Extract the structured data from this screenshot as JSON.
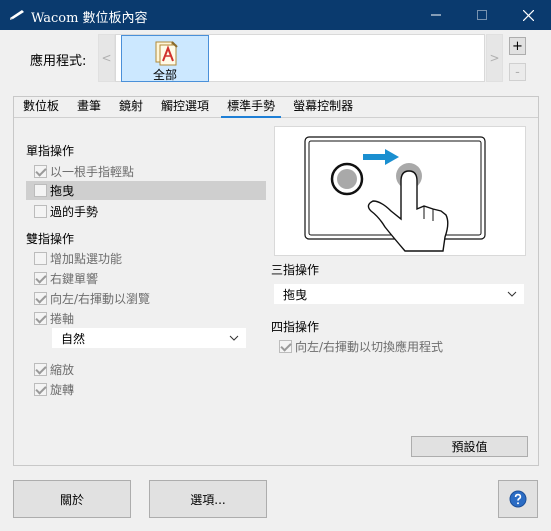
{
  "window": {
    "title": "Wacom 數位板內容"
  },
  "app_bar": {
    "label": "應用程式:",
    "left_arrow": "<",
    "right_arrow": ">",
    "selected_app": "全部",
    "add_label": "+",
    "remove_label": "-"
  },
  "tabs": [
    {
      "label": "數位板"
    },
    {
      "label": "畫筆"
    },
    {
      "label": "鏡射"
    },
    {
      "label": "觸控選項"
    },
    {
      "label": "標準手勢",
      "active": true
    },
    {
      "label": "螢幕控制器"
    }
  ],
  "single_finger": {
    "heading": "單指操作",
    "items": [
      {
        "label": "以一根手指輕點",
        "checked": true,
        "enabled": false
      },
      {
        "label": "拖曳",
        "checked": false,
        "enabled": true,
        "selected": true
      },
      {
        "label": "過的手勢",
        "checked": false,
        "enabled": true
      }
    ]
  },
  "two_finger": {
    "heading": "雙指操作",
    "items": [
      {
        "label": "增加點選功能",
        "checked": false,
        "enabled": false
      },
      {
        "label": "右鍵單響",
        "checked": true,
        "enabled": false
      },
      {
        "label": "向左/右揮動以瀏覽",
        "checked": true,
        "enabled": false
      },
      {
        "label": "捲軸",
        "checked": true,
        "enabled": false
      },
      {
        "label": "縮放",
        "checked": true,
        "enabled": false
      },
      {
        "label": "旋轉",
        "checked": true,
        "enabled": false
      }
    ],
    "scroll_select": {
      "value": "自然"
    }
  },
  "three_finger": {
    "heading": "三指操作",
    "select": {
      "value": "拖曳"
    }
  },
  "four_finger": {
    "heading": "四指操作",
    "item": {
      "label": "向左/右揮動以切換應用程式",
      "checked": true,
      "enabled": false
    }
  },
  "buttons": {
    "defaults": "預設值",
    "about": "關於",
    "options": "選項..."
  },
  "colors": {
    "titlebar": "#0a3a6e",
    "accent": "#1e7fd6",
    "illustration_blue": "#1a8fd0"
  }
}
